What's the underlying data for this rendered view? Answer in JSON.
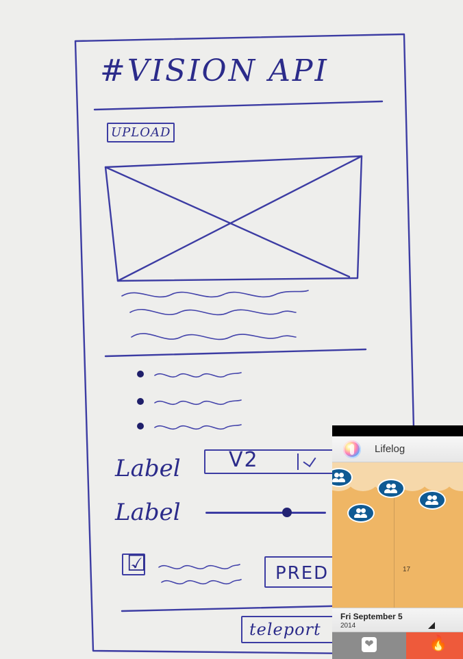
{
  "sketch": {
    "title": "#VISION API",
    "upload_label": "UPLOAD",
    "label_1": "Label",
    "label_2": "Label",
    "select_value": "V2",
    "checkbox_mark": "☑",
    "predict_label": "PRED",
    "teleport_label": "teleport"
  },
  "phone": {
    "app_name": "Lifelog",
    "day_number": "17",
    "date": {
      "main": "Fri September 5",
      "year": "2014"
    },
    "icons": {
      "app_icon": "lifelog-logo-icon",
      "people_bubble": "people-icon",
      "left_tab": "heart-icon",
      "right_tab": "flame-icon"
    },
    "colors": {
      "status_bar": "#000000",
      "app_bar": "#efefef",
      "timeline_bg": "#efb665",
      "cloud": "#f6d8aa",
      "bubble": "#0f5a93",
      "left_tab": "#8c8c8c",
      "right_tab": "#ee5a3b"
    }
  }
}
